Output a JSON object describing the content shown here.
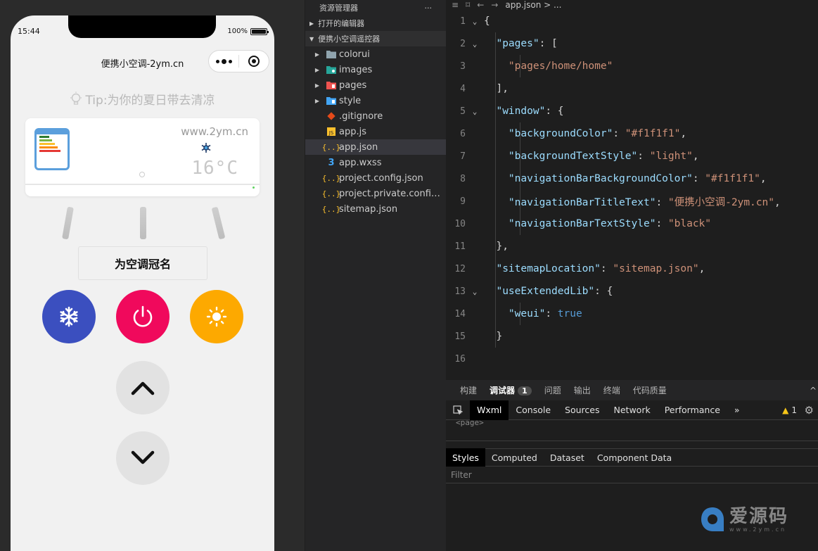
{
  "simulator": {
    "status_time": "15:44",
    "battery_text": "100%",
    "nav_title": "便携小空调-2ym.cn",
    "tip": "Tip:为你的夏日带去清凉",
    "ac_website": "www.2ym.cn",
    "ac_temp": "16°C",
    "name_button": "为空调冠名",
    "mode_buttons": [
      "cold",
      "power",
      "hot"
    ],
    "colors": {
      "cold": "#3b4fbf",
      "power": "#f0095c",
      "hot": "#fda900"
    }
  },
  "explorer": {
    "title": "资源管理器",
    "more": "···",
    "open_editors": "打开的编辑器",
    "project": "便携小空调遥控器",
    "items": [
      {
        "name": "colorui",
        "type": "folder",
        "icon": "folder-icon"
      },
      {
        "name": "images",
        "type": "folder",
        "icon": "images-folder-icon"
      },
      {
        "name": "pages",
        "type": "folder",
        "icon": "pages-folder-icon"
      },
      {
        "name": "style",
        "type": "folder",
        "icon": "style-folder-icon"
      },
      {
        "name": ".gitignore",
        "type": "file",
        "icon": "git-icon"
      },
      {
        "name": "app.js",
        "type": "file",
        "icon": "js-icon"
      },
      {
        "name": "app.json",
        "type": "file",
        "icon": "json-icon",
        "active": true
      },
      {
        "name": "app.wxss",
        "type": "file",
        "icon": "css-icon"
      },
      {
        "name": "project.config.json",
        "type": "file",
        "icon": "json-icon"
      },
      {
        "name": "project.private.config.js...",
        "type": "file",
        "icon": "json-icon"
      },
      {
        "name": "sitemap.json",
        "type": "file",
        "icon": "json-icon"
      }
    ]
  },
  "editor": {
    "breadcrumb": "app.json > ...",
    "line_numbers": [
      "1",
      "2",
      "3",
      "4",
      "5",
      "6",
      "7",
      "8",
      "9",
      "10",
      "11",
      "12",
      "13",
      "14",
      "15",
      "16"
    ]
  },
  "debug": {
    "top_tabs": [
      "构建",
      "调试器",
      "问题",
      "输出",
      "终端",
      "代码质量"
    ],
    "debugger_badge": "1",
    "dev_tabs": [
      "Wxml",
      "Console",
      "Sources",
      "Network",
      "Performance"
    ],
    "more": "»",
    "warning_count": "1",
    "wxml_line": "<page>",
    "style_tabs": [
      "Styles",
      "Computed",
      "Dataset",
      "Component Data"
    ],
    "filter_placeholder": "Filter",
    "watermark": "爱源码",
    "watermark_sub": "www.2ym.cn"
  }
}
